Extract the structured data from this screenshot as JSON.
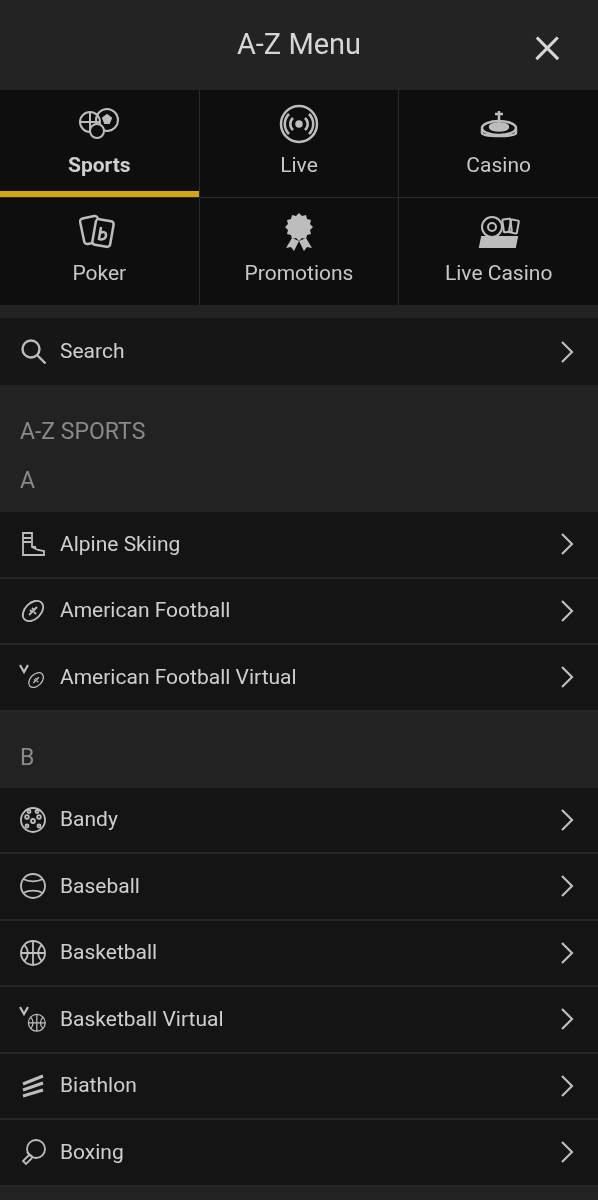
{
  "header": {
    "title": "A-Z Menu",
    "close": "×"
  },
  "tabs": [
    {
      "label": "Sports",
      "selected": true
    },
    {
      "label": "Live",
      "selected": false
    },
    {
      "label": "Casino",
      "selected": false
    },
    {
      "label": "Poker",
      "selected": false
    },
    {
      "label": "Promotions",
      "selected": false
    },
    {
      "label": "Live Casino",
      "selected": false
    }
  ],
  "search": {
    "label": "Search"
  },
  "section_title": "A-Z SPORTS",
  "groups": [
    {
      "letter": "A",
      "items": [
        "Alpine Skiing",
        "American Football",
        "American Football Virtual"
      ]
    },
    {
      "letter": "B",
      "items": [
        "Bandy",
        "Baseball",
        "Basketball",
        "Basketball Virtual",
        "Biathlon",
        "Boxing"
      ]
    }
  ]
}
